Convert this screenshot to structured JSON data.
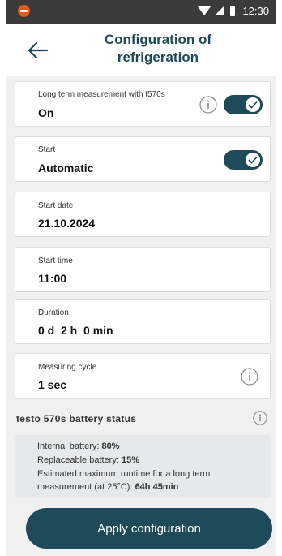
{
  "status_bar": {
    "time": "12:30",
    "app_icon": "testo-app-icon",
    "icons": [
      "wifi-icon",
      "signal-icon",
      "battery-icon"
    ]
  },
  "header": {
    "title_line1": "Configuration of",
    "title_line2": "refrigeration",
    "back_icon": "arrow-left-icon"
  },
  "settings": {
    "long_term": {
      "label": "Long term measurement with t570s",
      "value": "On",
      "toggle_on": true
    },
    "start": {
      "label": "Start",
      "value": "Automatic",
      "toggle_on": true
    },
    "start_date": {
      "label": "Start date",
      "value": "21.10.2024"
    },
    "start_time": {
      "label": "Start time",
      "value": "11:00"
    },
    "duration": {
      "label": "Duration",
      "value": "0 d  2 h  0 min"
    },
    "measuring_cycle": {
      "label": "Measuring cycle",
      "value": "1 sec"
    }
  },
  "battery": {
    "title": "testo 570s battery status",
    "internal_label": "Internal battery: ",
    "internal_value": "80%",
    "replaceable_label": "Replaceable battery: ",
    "replaceable_value": "15%",
    "runtime_line1": "Estimated maximum runtime for a long term",
    "runtime_label": "measurement (at 25°C): ",
    "runtime_value": "64h 45min"
  },
  "apply_button": "Apply configuration",
  "colors": {
    "accent": "#1f4a5a",
    "status_bar": "#3b3b3b",
    "background": "#f0f0f0",
    "app_icon": "#e8581a"
  }
}
